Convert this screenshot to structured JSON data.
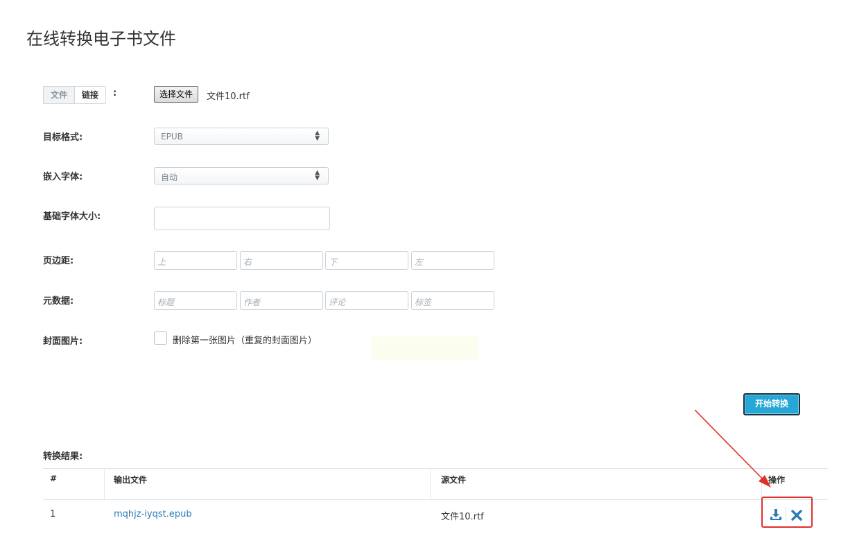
{
  "page": {
    "title": "在线转换电子书文件"
  },
  "source": {
    "mode_tabs": [
      "文件",
      "链接"
    ],
    "colon": ":",
    "file_button": "选择文件",
    "file_name": "文件10.rtf"
  },
  "form": {
    "target_format": {
      "label": "目标格式:",
      "value": "EPUB"
    },
    "embed_font": {
      "label": "嵌入字体:",
      "value": "自动"
    },
    "base_font_size": {
      "label": "基础字体大小:",
      "value": ""
    },
    "margins": {
      "label": "页边距:",
      "placeholders": [
        "上",
        "右",
        "下",
        "左"
      ]
    },
    "metadata": {
      "label": "元数据:",
      "placeholders": [
        "标题",
        "作者",
        "评论",
        "标签"
      ]
    },
    "cover": {
      "label": "封面图片:",
      "checkbox_label": "删除第一张图片（重复的封面图片）",
      "checked": false
    }
  },
  "actions": {
    "start_label": "开始转换"
  },
  "results": {
    "title": "转换结果:",
    "columns": [
      "#",
      "输出文件",
      "源文件",
      "操作"
    ],
    "rows": [
      {
        "index": "1",
        "output": "mqhjz-iyqst.epub",
        "source": "文件10.rtf"
      }
    ]
  },
  "colors": {
    "accent": "#27a7d6",
    "link": "#2a7bb6",
    "annotation": "#e0302a"
  },
  "icons": {
    "download": "download-icon",
    "delete": "delete-icon",
    "select_arrows": "sort-arrows-icon"
  }
}
